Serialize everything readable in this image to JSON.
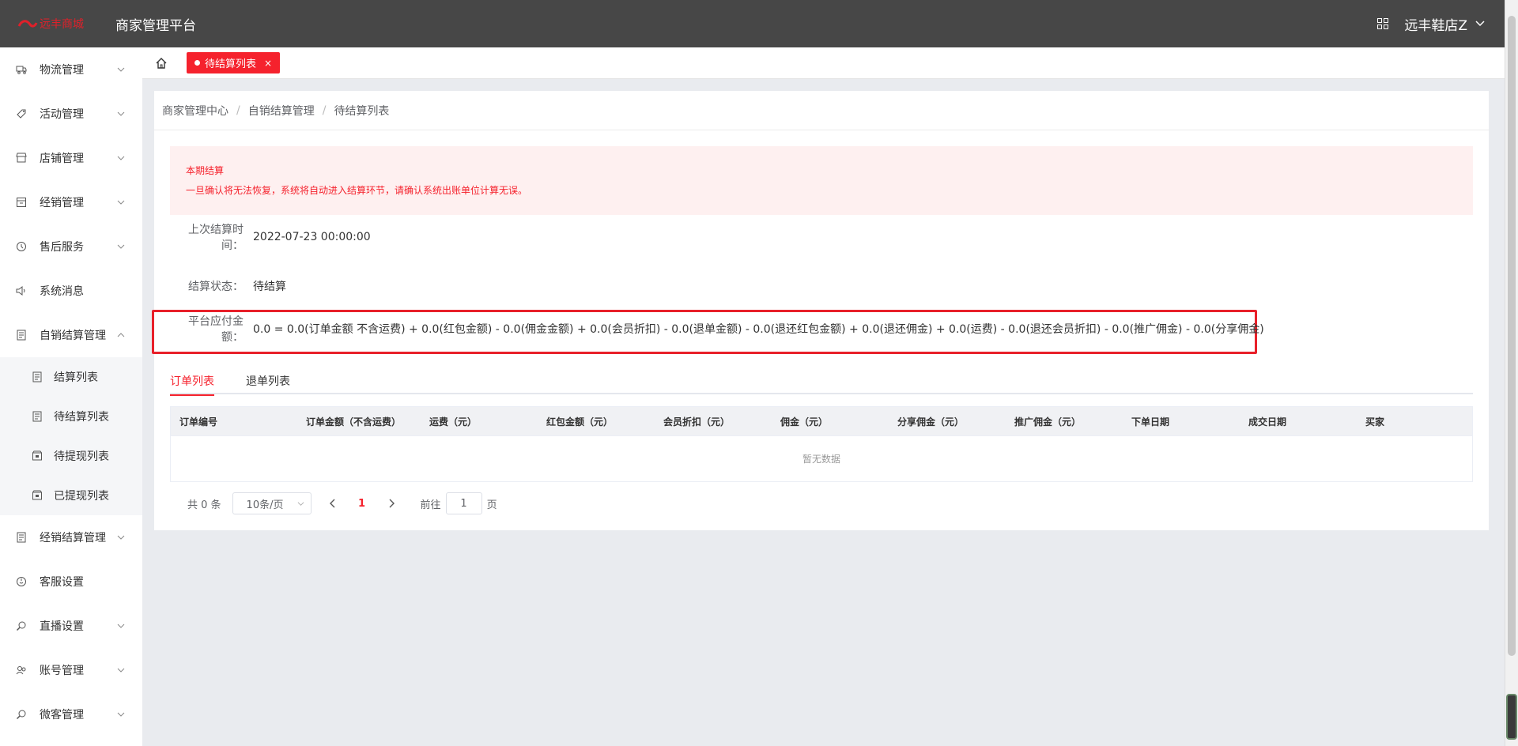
{
  "header": {
    "logo_text": "远丰商城",
    "platform_title": "商家管理平台",
    "shop_name": "远丰鞋店Z"
  },
  "sidebar": {
    "items": [
      {
        "label": "物流管理",
        "icon": "truck-icon"
      },
      {
        "label": "活动管理",
        "icon": "tag-icon"
      },
      {
        "label": "店铺管理",
        "icon": "shop-icon"
      },
      {
        "label": "经销管理",
        "icon": "box-icon"
      },
      {
        "label": "售后服务",
        "icon": "clock-icon"
      },
      {
        "label": "系统消息",
        "icon": "speaker-icon"
      },
      {
        "label": "自销结算管理",
        "icon": "document-icon"
      },
      {
        "label": "经销结算管理",
        "icon": "document-icon"
      },
      {
        "label": "客服设置",
        "icon": "headset-icon"
      },
      {
        "label": "直播设置",
        "icon": "search-icon"
      },
      {
        "label": "账号管理",
        "icon": "users-icon"
      },
      {
        "label": "微客管理",
        "icon": "search-icon"
      }
    ],
    "submenu": [
      {
        "label": "结算列表",
        "icon": "document-icon"
      },
      {
        "label": "待结算列表",
        "icon": "document-icon"
      },
      {
        "label": "待提现列表",
        "icon": "wallet-icon"
      },
      {
        "label": "已提现列表",
        "icon": "wallet-icon"
      }
    ]
  },
  "tabs": {
    "active_label": "待结算列表",
    "close": "×"
  },
  "breadcrumb": {
    "items": [
      "商家管理中心",
      "自销结算管理",
      "待结算列表"
    ],
    "sep": "/"
  },
  "alert": {
    "title": "本期结算",
    "desc": "一旦确认将无法恢复，系统将自动进入结算环节，请确认系统出账单位计算无误。"
  },
  "form": {
    "last_time_label": "上次结算时间：",
    "last_time_value": "2022-07-23 00:00:00",
    "status_label": "结算状态：",
    "status_value": "待结算",
    "amount_label": "平台应付金额：",
    "amount_value": "0.0 = 0.0(订单金额 不含运费) + 0.0(红包金额) - 0.0(佣金金额) + 0.0(会员折扣) - 0.0(退单金额) - 0.0(退还红包金额) + 0.0(退还佣金) + 0.0(运费) - 0.0(退还会员折扣) - 0.0(推广佣金) - 0.0(分享佣金)"
  },
  "sub_tabs": [
    "订单列表",
    "退单列表"
  ],
  "table": {
    "columns": [
      "订单编号",
      "订单金额（不含运费）",
      "运费（元）",
      "红包金额（元）",
      "会员折扣（元）",
      "佣金（元）",
      "分享佣金（元）",
      "推广佣金（元）",
      "下单日期",
      "成交日期",
      "买家"
    ],
    "empty_text": "暂无数据"
  },
  "pagination": {
    "total": "共 0 条",
    "page_size": "10条/页",
    "current_page": "1",
    "goto_label": "前往",
    "goto_value": "1",
    "goto_suffix": "页"
  },
  "colors": {
    "accent": "#f5222d",
    "header_bg": "#474747",
    "highlight_border": "#e8202a"
  }
}
